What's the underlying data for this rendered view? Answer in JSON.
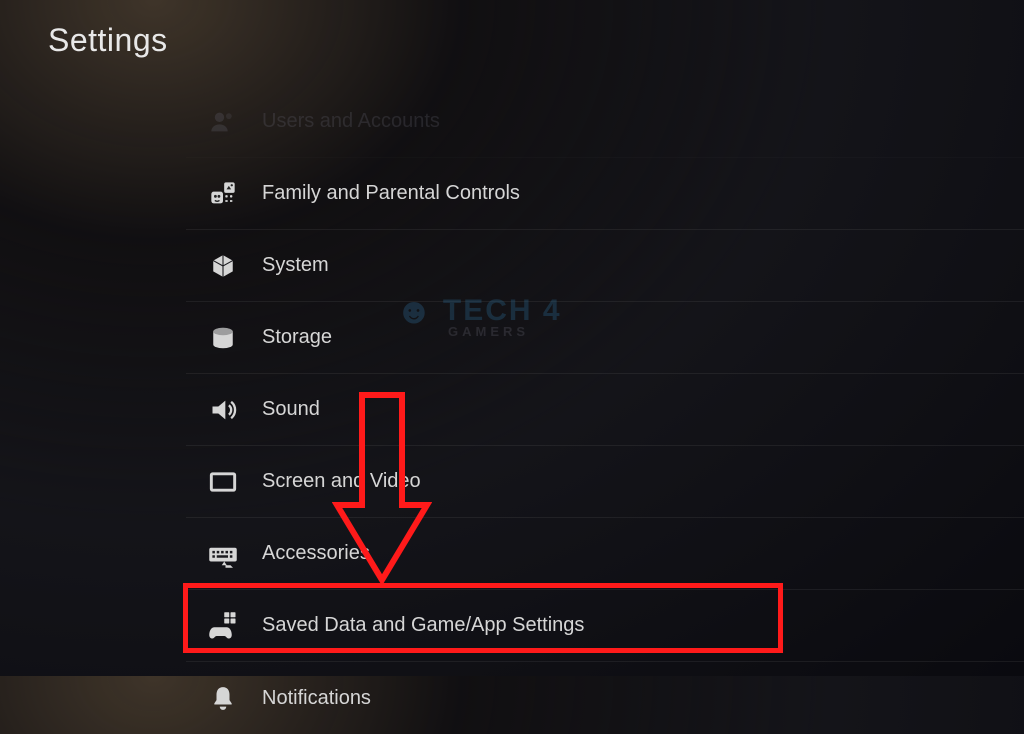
{
  "page_title": "Settings",
  "menu_items": [
    {
      "label": "Users and Accounts",
      "icon": "users-icon",
      "faded": true
    },
    {
      "label": "Family and Parental Controls",
      "icon": "family-icon",
      "faded": false
    },
    {
      "label": "System",
      "icon": "cube-icon",
      "faded": false
    },
    {
      "label": "Storage",
      "icon": "storage-icon",
      "faded": false
    },
    {
      "label": "Sound",
      "icon": "sound-icon",
      "faded": false
    },
    {
      "label": "Screen and Video",
      "icon": "screen-icon",
      "faded": false
    },
    {
      "label": "Accessories",
      "icon": "keyboard-icon",
      "faded": false
    },
    {
      "label": "Saved Data and Game/App Settings",
      "icon": "gamepad-icon",
      "faded": false
    },
    {
      "label": "Notifications",
      "icon": "bell-icon",
      "faded": false
    }
  ],
  "watermark": {
    "main": "TECH 4",
    "sub": "GAMERS"
  },
  "annotation": {
    "highlight_index": 7,
    "arrow_color": "#ff1a1a",
    "box_color": "#ff1a1a"
  }
}
